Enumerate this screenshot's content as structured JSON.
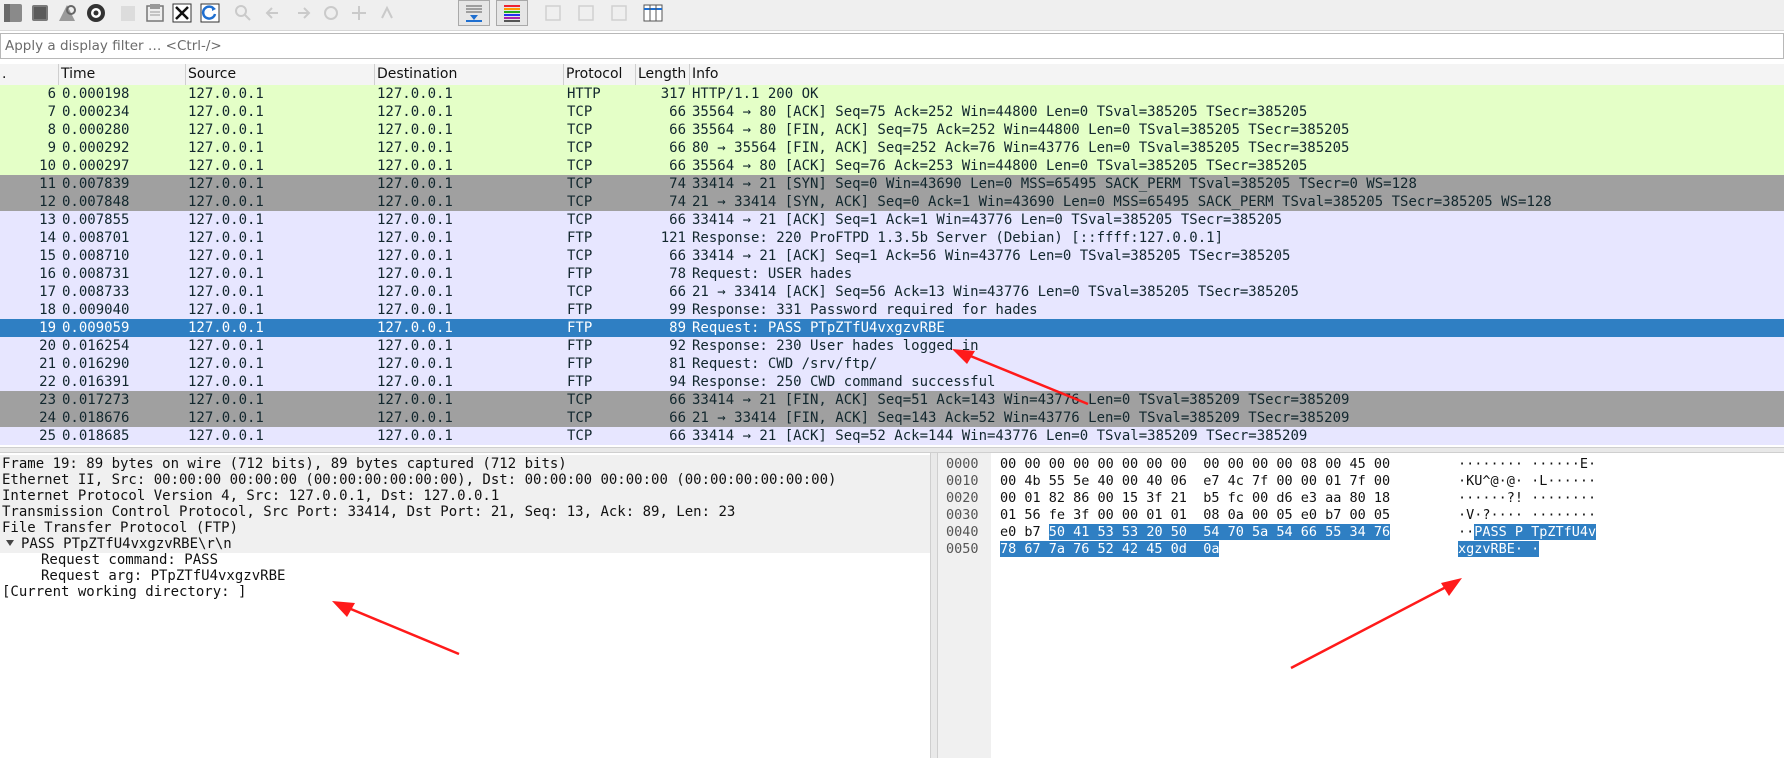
{
  "toolbar": {
    "icons": [
      "fin-icon",
      "stop-icon",
      "restart-shark-icon",
      "capture-options-icon",
      "open-icon",
      "save-icon",
      "close-file-icon",
      "reload-icon",
      "find-icon",
      "go-back-icon",
      "go-forward-icon",
      "jump-icon",
      "first-icon",
      "last-icon",
      "autoscroll-icon",
      "colorize-icon",
      "zoom-in-icon",
      "zoom-out-icon",
      "normal-size-icon",
      "resize-columns-icon"
    ]
  },
  "filter": {
    "placeholder": "Apply a display filter … <Ctrl-/>"
  },
  "columns": [
    ".",
    "Time",
    "Source",
    "Destination",
    "Protocol",
    "Length",
    "Info"
  ],
  "packets": [
    {
      "no": "6",
      "time": "0.000198",
      "src": "127.0.0.1",
      "dst": "127.0.0.1",
      "proto": "HTTP",
      "len": "317",
      "info": "HTTP/1.1 200 OK",
      "style": "g"
    },
    {
      "no": "7",
      "time": "0.000234",
      "src": "127.0.0.1",
      "dst": "127.0.0.1",
      "proto": "TCP",
      "len": "66",
      "info": "35564 → 80 [ACK] Seq=75 Ack=252 Win=44800 Len=0 TSval=385205 TSecr=385205",
      "style": "g"
    },
    {
      "no": "8",
      "time": "0.000280",
      "src": "127.0.0.1",
      "dst": "127.0.0.1",
      "proto": "TCP",
      "len": "66",
      "info": "35564 → 80 [FIN, ACK] Seq=75 Ack=252 Win=44800 Len=0 TSval=385205 TSecr=385205",
      "style": "g"
    },
    {
      "no": "9",
      "time": "0.000292",
      "src": "127.0.0.1",
      "dst": "127.0.0.1",
      "proto": "TCP",
      "len": "66",
      "info": "80 → 35564 [FIN, ACK] Seq=252 Ack=76 Win=43776 Len=0 TSval=385205 TSecr=385205",
      "style": "g"
    },
    {
      "no": "10",
      "time": "0.000297",
      "src": "127.0.0.1",
      "dst": "127.0.0.1",
      "proto": "TCP",
      "len": "66",
      "info": "35564 → 80 [ACK] Seq=76 Ack=253 Win=44800 Len=0 TSval=385205 TSecr=385205",
      "style": "g"
    },
    {
      "no": "11",
      "time": "0.007839",
      "src": "127.0.0.1",
      "dst": "127.0.0.1",
      "proto": "TCP",
      "len": "74",
      "info": "33414 → 21 [SYN] Seq=0 Win=43690 Len=0 MSS=65495 SACK_PERM TSval=385205 TSecr=0 WS=128",
      "style": "d"
    },
    {
      "no": "12",
      "time": "0.007848",
      "src": "127.0.0.1",
      "dst": "127.0.0.1",
      "proto": "TCP",
      "len": "74",
      "info": "21 → 33414 [SYN, ACK] Seq=0 Ack=1 Win=43690 Len=0 MSS=65495 SACK_PERM TSval=385205 TSecr=385205 WS=128",
      "style": "d"
    },
    {
      "no": "13",
      "time": "0.007855",
      "src": "127.0.0.1",
      "dst": "127.0.0.1",
      "proto": "TCP",
      "len": "66",
      "info": "33414 → 21 [ACK] Seq=1 Ack=1 Win=43776 Len=0 TSval=385205 TSecr=385205",
      "style": "l"
    },
    {
      "no": "14",
      "time": "0.008701",
      "src": "127.0.0.1",
      "dst": "127.0.0.1",
      "proto": "FTP",
      "len": "121",
      "info": "Response: 220 ProFTPD 1.3.5b Server (Debian) [::ffff:127.0.0.1]",
      "style": "l"
    },
    {
      "no": "15",
      "time": "0.008710",
      "src": "127.0.0.1",
      "dst": "127.0.0.1",
      "proto": "TCP",
      "len": "66",
      "info": "33414 → 21 [ACK] Seq=1 Ack=56 Win=43776 Len=0 TSval=385205 TSecr=385205",
      "style": "l"
    },
    {
      "no": "16",
      "time": "0.008731",
      "src": "127.0.0.1",
      "dst": "127.0.0.1",
      "proto": "FTP",
      "len": "78",
      "info": "Request: USER hades",
      "style": "l"
    },
    {
      "no": "17",
      "time": "0.008733",
      "src": "127.0.0.1",
      "dst": "127.0.0.1",
      "proto": "TCP",
      "len": "66",
      "info": "21 → 33414 [ACK] Seq=56 Ack=13 Win=43776 Len=0 TSval=385205 TSecr=385205",
      "style": "l"
    },
    {
      "no": "18",
      "time": "0.009040",
      "src": "127.0.0.1",
      "dst": "127.0.0.1",
      "proto": "FTP",
      "len": "99",
      "info": "Response: 331 Password required for hades",
      "style": "l"
    },
    {
      "no": "19",
      "time": "0.009059",
      "src": "127.0.0.1",
      "dst": "127.0.0.1",
      "proto": "FTP",
      "len": "89",
      "info": "Request: PASS PTpZTfU4vxgzvRBE",
      "style": "sel"
    },
    {
      "no": "20",
      "time": "0.016254",
      "src": "127.0.0.1",
      "dst": "127.0.0.1",
      "proto": "FTP",
      "len": "92",
      "info": "Response: 230 User hades logged in",
      "style": "l"
    },
    {
      "no": "21",
      "time": "0.016290",
      "src": "127.0.0.1",
      "dst": "127.0.0.1",
      "proto": "FTP",
      "len": "81",
      "info": "Request: CWD /srv/ftp/",
      "style": "l"
    },
    {
      "no": "22",
      "time": "0.016391",
      "src": "127.0.0.1",
      "dst": "127.0.0.1",
      "proto": "FTP",
      "len": "94",
      "info": "Response: 250 CWD command successful",
      "style": "l"
    },
    {
      "no": "23",
      "time": "0.017273",
      "src": "127.0.0.1",
      "dst": "127.0.0.1",
      "proto": "TCP",
      "len": "66",
      "info": "33414 → 21 [FIN, ACK] Seq=51 Ack=143 Win=43776 Len=0 TSval=385209 TSecr=385209",
      "style": "d"
    },
    {
      "no": "24",
      "time": "0.018676",
      "src": "127.0.0.1",
      "dst": "127.0.0.1",
      "proto": "TCP",
      "len": "66",
      "info": "21 → 33414 [FIN, ACK] Seq=143 Ack=52 Win=43776 Len=0 TSval=385209 TSecr=385209",
      "style": "d"
    },
    {
      "no": "25",
      "time": "0.018685",
      "src": "127.0.0.1",
      "dst": "127.0.0.1",
      "proto": "TCP",
      "len": "66",
      "info": "33414 → 21 [ACK] Seq=52 Ack=144 Win=43776 Len=0 TSval=385209 TSecr=385209",
      "style": "l"
    }
  ],
  "details": [
    {
      "text": "Frame 19: 89 bytes on wire (712 bits), 89 bytes captured (712 bits)",
      "indent": 0,
      "shade": true
    },
    {
      "text": "Ethernet II, Src: 00:00:00_00:00:00 (00:00:00:00:00:00), Dst: 00:00:00_00:00:00 (00:00:00:00:00:00)",
      "indent": 0,
      "shade": true
    },
    {
      "text": "Internet Protocol Version 4, Src: 127.0.0.1, Dst: 127.0.0.1",
      "indent": 0,
      "shade": true
    },
    {
      "text": "Transmission Control Protocol, Src Port: 33414, Dst Port: 21, Seq: 13, Ack: 89, Len: 23",
      "indent": 0,
      "shade": true
    },
    {
      "text": "File Transfer Protocol (FTP)",
      "indent": 0,
      "shade": true
    },
    {
      "text": "PASS PTpZTfU4vxgzvRBE\\r\\n",
      "indent": 1,
      "shade": true,
      "expanded": true
    },
    {
      "text": "Request command: PASS",
      "indent": 2,
      "shade": false
    },
    {
      "text": "Request arg: PTpZTfU4vxgzvRBE",
      "indent": 2,
      "shade": false
    },
    {
      "text": "[Current working directory: ]",
      "indent": 0,
      "shade": false
    }
  ],
  "bytes": [
    {
      "off": "0000",
      "hex_plain": "00 00 00 00 00 00 00 00  00 00 00 00 08 00 45 00",
      "hex_hl": "",
      "ascii_plain": "········ ······E·",
      "ascii_hl": ""
    },
    {
      "off": "0010",
      "hex_plain": "00 4b 55 5e 40 00 40 06  e7 4c 7f 00 00 01 7f 00",
      "hex_hl": "",
      "ascii_plain": "·KU^@·@· ·L······",
      "ascii_hl": ""
    },
    {
      "off": "0020",
      "hex_plain": "00 01 82 86 00 15 3f 21  b5 fc 00 d6 e3 aa 80 18",
      "hex_hl": "",
      "ascii_plain": "······?! ········",
      "ascii_hl": ""
    },
    {
      "off": "0030",
      "hex_plain": "01 56 fe 3f 00 00 01 01  08 0a 00 05 e0 b7 00 05",
      "hex_hl": "",
      "ascii_plain": "·V·?···· ········",
      "ascii_hl": ""
    },
    {
      "off": "0040",
      "hex_plain": "e0 b7 ",
      "hex_hl": "50 41 53 53 20 50  54 70 5a 54 66 55 34 76",
      "ascii_plain": "··",
      "ascii_hl": "PASS P TpZTfU4v"
    },
    {
      "off": "0050",
      "hex_plain": "",
      "hex_hl": "78 67 7a 76 52 42 45 0d  0a",
      "ascii_plain": "",
      "ascii_hl": "xgzvRBE· ·"
    }
  ],
  "colors": {
    "row_green": "#e4ffc7",
    "row_gray": "#a0a0a0",
    "row_lavender": "#e7e6ff",
    "row_selected": "#2f7fc3",
    "annotation_red": "#ff1a1a"
  }
}
